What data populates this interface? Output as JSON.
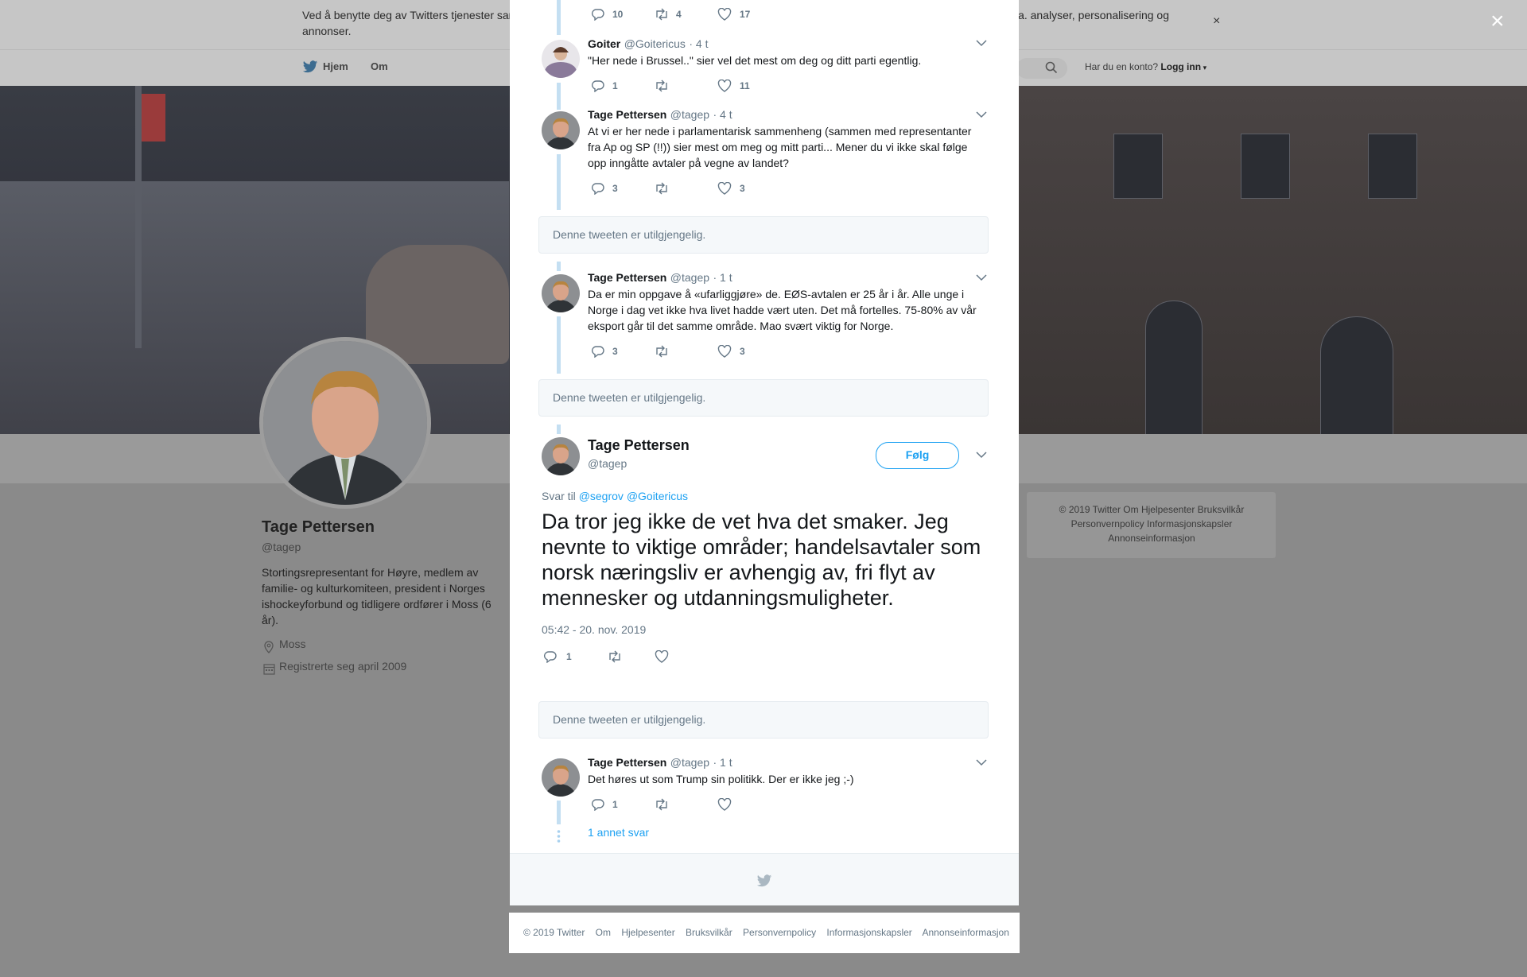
{
  "cookie": {
    "text": "Ved å benytte deg av Twitters tjenester samtykker du i vår bruk av informasjonskapsler og deling av data med partnere. Informasjonskapsler til bl.a. analyser, personalisering og annonser.",
    "close_label": "×"
  },
  "nav": {
    "home": "Hjem",
    "about": "Om",
    "account_prompt": "Har du en konto?",
    "login": "Logg inn"
  },
  "profile": {
    "name": "Tage Pettersen",
    "handle": "@tagep",
    "bio": "Stortingsrepresentant for Høyre, medlem av familie- og kulturkomiteen, president i Norges ishockeyforbund og tidligere ordfører i Moss (6 år).",
    "location": "Moss",
    "joined": "Registrerte seg april 2009"
  },
  "side_footer": "© 2019 Twitter   Om   Hjelpesenter   Bruksvilkår   Personvernpolicy   Informasjonskapsler   Annonseinformasjon",
  "modal_close": "×",
  "tweets": [
    {
      "replies": "10",
      "retweets": "4",
      "likes": "17"
    },
    {
      "name": "Goiter",
      "handle": "@Goitericus",
      "time": "· 4 t",
      "text": "\"Her nede i Brussel..\" sier vel det mest om deg og ditt parti egentlig.",
      "replies": "1",
      "retweets": "",
      "likes": "11"
    },
    {
      "name": "Tage Pettersen",
      "handle": "@tagep",
      "time": "· 4 t",
      "text": "At vi er her nede i parlamentarisk sammenheng (sammen med representanter fra Ap og SP (!!)) sier mest om meg og mitt parti... Mener du vi ikke skal følge opp inngåtte avtaler på vegne av landet?",
      "replies": "3",
      "retweets": "",
      "likes": "3"
    },
    {
      "name": "Tage Pettersen",
      "handle": "@tagep",
      "time": "· 1 t",
      "text": "Da er min oppgave å «ufarliggjøre» de. EØS-avtalen er 25 år i år. Alle unge i Norge i dag vet ikke hva livet hadde vært uten. Det må fortelles. 75-80% av vår eksport går til det samme område. Mao svært viktig for Norge.",
      "replies": "3",
      "retweets": "",
      "likes": "3"
    }
  ],
  "unavailable": "Denne tweeten er utilgjengelig.",
  "main_tweet": {
    "name": "Tage Pettersen",
    "handle": "@tagep",
    "follow": "Følg",
    "reply_to_label": "Svar til",
    "reply_to_1": "@segrov",
    "reply_to_2": "@Goitericus",
    "text": "Da tror jeg ikke de vet hva det smaker. Jeg nevnte to viktige områder; handelsavtaler som norsk næringsliv er avhengig av, fri flyt av mennesker og utdanningsmuligheter.",
    "timestamp": "05:42 - 20. nov. 2019",
    "replies": "1"
  },
  "last_tweet": {
    "name": "Tage Pettersen",
    "handle": "@tagep",
    "time": "· 1 t",
    "text": "Det høres ut som Trump sin politikk. Der er ikke jeg ;-)",
    "replies": "1",
    "more_replies": "1 annet svar"
  },
  "bottom_footer": "© 2019 Twitter    Om    Hjelpesenter    Bruksvilkår    Personvernpolicy    Informasjonskapsler    Annonseinformasjon",
  "colors": {
    "accent": "#1da1f2",
    "thread": "#c4dff2",
    "overlay": "#8a8a8a"
  }
}
